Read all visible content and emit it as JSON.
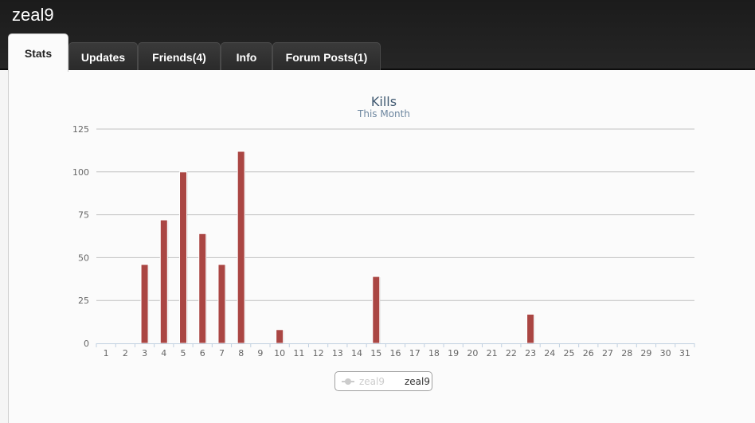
{
  "profile": {
    "username": "zeal9"
  },
  "tabs": [
    {
      "label": "Stats",
      "active": true
    },
    {
      "label": "Updates",
      "active": false
    },
    {
      "label": "Friends(4)",
      "active": false
    },
    {
      "label": "Info",
      "active": false
    },
    {
      "label": "Forum Posts(1)",
      "active": false
    }
  ],
  "chart_data": {
    "type": "bar",
    "title": "Kills",
    "subtitle": "This Month",
    "categories": [
      "1",
      "2",
      "3",
      "4",
      "5",
      "6",
      "7",
      "8",
      "9",
      "10",
      "11",
      "12",
      "13",
      "14",
      "15",
      "16",
      "17",
      "18",
      "19",
      "20",
      "21",
      "22",
      "23",
      "24",
      "25",
      "26",
      "27",
      "28",
      "29",
      "30",
      "31"
    ],
    "ylim": [
      0,
      125
    ],
    "yticks": [
      0,
      25,
      50,
      75,
      100,
      125
    ],
    "grid": true,
    "series": [
      {
        "name": "zeal9",
        "type": "line",
        "color": "#cccccc",
        "visible": false,
        "values": []
      },
      {
        "name": "zeal9",
        "type": "bar",
        "color": "#aa4643",
        "visible": true,
        "values": [
          0,
          0,
          46,
          72,
          100,
          64,
          46,
          112,
          0,
          8,
          0,
          0,
          0,
          0,
          39,
          0,
          0,
          0,
          0,
          0,
          0,
          0,
          17,
          0,
          0,
          0,
          0,
          0,
          0,
          0,
          0
        ]
      }
    ],
    "legend": "bottom-center"
  }
}
